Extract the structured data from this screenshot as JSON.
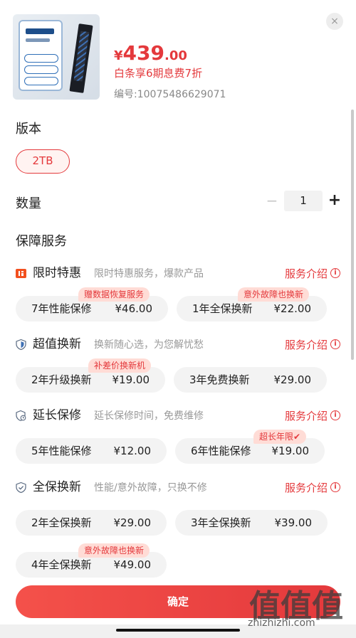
{
  "product": {
    "price_currency": "¥",
    "price_int": "439",
    "price_dec": ".00",
    "promo": "白条享6期息费7折",
    "sku": "编号:10075486629071"
  },
  "close_icon": "×",
  "version": {
    "title": "版本",
    "selected": "2TB"
  },
  "quantity": {
    "title": "数量",
    "minus": "−",
    "value": "1",
    "plus": "+"
  },
  "warranty": {
    "title": "保障服务"
  },
  "services": [
    {
      "name": "限时特惠",
      "desc": "限时特惠服务，爆款产品",
      "intro": "服务介绍",
      "icon": "flash-sale-icon",
      "options": [
        {
          "label": "7年性能保修",
          "price": "¥46.00",
          "tag": "赠数据恢复服务"
        },
        {
          "label": "1年全保换新",
          "price": "¥22.00",
          "tag": "意外故障也换新"
        }
      ]
    },
    {
      "name": "超值换新",
      "desc": "换新随心选，为您解忧愁",
      "intro": "服务介绍",
      "icon": "shield-icon",
      "options": [
        {
          "label": "2年升级换新",
          "price": "¥19.00",
          "tag": "补差价换新机"
        },
        {
          "label": "3年免费换新",
          "price": "¥29.00",
          "tag": ""
        }
      ]
    },
    {
      "name": "延长保修",
      "desc": "延长保修时间，免费维修",
      "intro": "服务介绍",
      "icon": "extended-warranty-icon",
      "options": [
        {
          "label": "5年性能保修",
          "price": "¥12.00",
          "tag": ""
        },
        {
          "label": "6年性能保修",
          "price": "¥19.00",
          "tag": "超长年限✔"
        }
      ]
    },
    {
      "name": "全保换新",
      "desc": "性能/意外故障，只换不修",
      "intro": "服务介绍",
      "icon": "shield-check-icon",
      "options": [
        {
          "label": "2年全保换新",
          "price": "¥29.00",
          "tag": ""
        },
        {
          "label": "3年全保换新",
          "price": "¥39.00",
          "tag": ""
        },
        {
          "label": "4年全保换新",
          "price": "¥49.00",
          "tag": "意外故障也换新"
        }
      ]
    }
  ],
  "info_icon": "i",
  "confirm_label": "确定",
  "watermark": {
    "text": "值值值",
    "url": "zhizhizhi.com"
  },
  "colors": {
    "accent": "#e4393c",
    "tag_bg": "#ffdcd6",
    "option_bg": "#f3f3f3"
  }
}
